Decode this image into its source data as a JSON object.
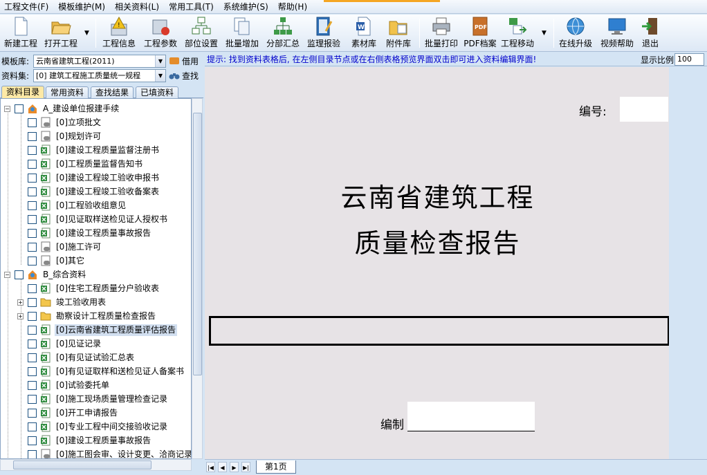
{
  "menu": [
    "工程文件(F)",
    "模板维护(M)",
    "相关资料(L)",
    "常用工具(T)",
    "系统维护(S)",
    "帮助(H)"
  ],
  "toolbar": {
    "new": "新建工程",
    "open": "打开工程",
    "info": "工程信息",
    "params": "工程参数",
    "part": "部位设置",
    "batch_add": "批量增加",
    "sub_sum": "分部汇总",
    "supervise": "监理报验",
    "material": "素材库",
    "attach": "附件库",
    "batch_print": "批量打印",
    "pdf": "PDF档案",
    "move": "工程移动",
    "upgrade": "在线升级",
    "video": "视频帮助",
    "exit": "退出"
  },
  "left": {
    "template_label": "模板库:",
    "template_value": "云南省建筑工程(2011)",
    "borrow": "借用",
    "set_label": "资料集:",
    "set_value": "[0] 建筑工程施工质量统一规程",
    "search": "查找"
  },
  "tabs": [
    "资料目录",
    "常用资料",
    "查找结果",
    "已填资料"
  ],
  "tree": [
    {
      "t": "A_建设单位报建手续",
      "lv": 0,
      "icon": "group"
    },
    {
      "t": "[0]立项批文",
      "lv": 1,
      "icon": "form"
    },
    {
      "t": "[0]规划许可",
      "lv": 1,
      "icon": "form"
    },
    {
      "t": "[0]建设工程质量监督注册书",
      "lv": 1,
      "icon": "excel"
    },
    {
      "t": "[0]工程质量监督告知书",
      "lv": 1,
      "icon": "excel"
    },
    {
      "t": "[0]建设工程竣工验收申报书",
      "lv": 1,
      "icon": "excel"
    },
    {
      "t": "[0]建设工程竣工验收备案表",
      "lv": 1,
      "icon": "excel"
    },
    {
      "t": "[0]工程验收组意见",
      "lv": 1,
      "icon": "excel"
    },
    {
      "t": "[0]见证取样送检见证人授权书",
      "lv": 1,
      "icon": "excel"
    },
    {
      "t": "[0]建设工程质量事故报告",
      "lv": 1,
      "icon": "excel"
    },
    {
      "t": "[0]施工许可",
      "lv": 1,
      "icon": "form"
    },
    {
      "t": "[0]其它",
      "lv": 1,
      "icon": "form"
    },
    {
      "t": "B_综合资料",
      "lv": 0,
      "icon": "group"
    },
    {
      "t": "[0]住宅工程质量分户验收表",
      "lv": 1,
      "icon": "excel"
    },
    {
      "t": "竣工验收用表",
      "lv": 1,
      "icon": "folder",
      "exp": true
    },
    {
      "t": "勘察设计工程质量检查报告",
      "lv": 1,
      "icon": "folder",
      "exp": true
    },
    {
      "t": "[0]云南省建筑工程质量评估报告",
      "lv": 1,
      "icon": "excel",
      "sel": true
    },
    {
      "t": "[0]见证记录",
      "lv": 1,
      "icon": "excel"
    },
    {
      "t": "[0]有见证试验汇总表",
      "lv": 1,
      "icon": "excel"
    },
    {
      "t": "[0]有见证取样和送检见证人备案书",
      "lv": 1,
      "icon": "excel"
    },
    {
      "t": "[0]试验委托单",
      "lv": 1,
      "icon": "excel"
    },
    {
      "t": "[0]施工现场质量管理检查记录",
      "lv": 1,
      "icon": "excel"
    },
    {
      "t": "[0]开工申请报告",
      "lv": 1,
      "icon": "excel"
    },
    {
      "t": "[0]专业工程中间交接验收记录",
      "lv": 1,
      "icon": "excel"
    },
    {
      "t": "[0]建设工程质量事故报告",
      "lv": 1,
      "icon": "excel"
    },
    {
      "t": "[0]施工图会审、设计变更、洽商记录",
      "lv": 1,
      "icon": "form"
    }
  ],
  "hint": "提示: 找到资料表格后, 在左侧目录节点或在右侧表格预览界面双击即可进入资料编辑界面!",
  "zoom": {
    "label": "显示比例",
    "value": "100"
  },
  "doc": {
    "number_label": "编号:",
    "title1": "云南省建筑工程",
    "title2": "质量检查报告",
    "editor_label": "编制"
  },
  "sheet": "第1页"
}
